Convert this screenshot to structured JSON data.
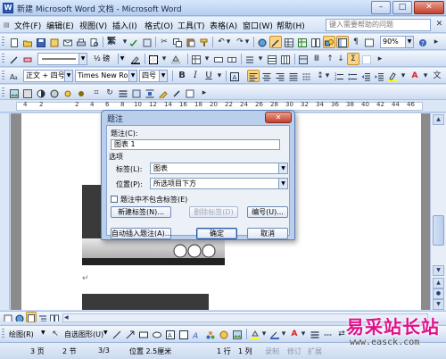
{
  "window": {
    "title": "新建 Microsoft Word 文档 - Microsoft Word"
  },
  "menu": {
    "items": [
      "文件(F)",
      "编辑(E)",
      "视图(V)",
      "插入(I)",
      "格式(O)",
      "工具(T)",
      "表格(A)",
      "窗口(W)",
      "帮助(H)"
    ],
    "help_placeholder": "键入需要帮助的问题"
  },
  "toolbar_standard": {
    "undo_dd": "▾",
    "zoom": "90%"
  },
  "toolbar_drawing_top": {
    "line_weight": "½ 磅"
  },
  "toolbar_formatting": {
    "style": "正文 + 四号",
    "font": "Times New Roman",
    "size": "四号",
    "bold": "B",
    "italic": "I",
    "underline": "U",
    "font_color_letter": "A"
  },
  "ruler": {
    "numbers": [
      "4",
      "2",
      "2",
      "4",
      "6",
      "8",
      "10",
      "12",
      "14",
      "16",
      "18",
      "20",
      "22",
      "24",
      "26",
      "28",
      "30",
      "32",
      "34",
      "36",
      "38",
      "40",
      "42",
      "44",
      "46"
    ]
  },
  "dialog": {
    "title": "题注",
    "close_glyph": "✕",
    "caption_label": "题注(C):",
    "caption_value": "图表 1",
    "options_label": "选项",
    "label_label": "标签(L):",
    "label_value": "图表",
    "position_label": "位置(P):",
    "position_value": "所选项目下方",
    "exclude_label": "题注中不包含标签(E)",
    "buttons": {
      "new_label": "新建标签(N)...",
      "delete_label": "删除标签(D)",
      "numbering": "编号(U)...",
      "autocaption": "自动插入题注(A)...",
      "ok": "确定",
      "cancel": "取消"
    }
  },
  "document": {
    "paragraph_mark": "↵"
  },
  "drawing_toolbar": {
    "draw": "绘图(R)",
    "autoshapes": "自选图形(U)"
  },
  "status_bar": {
    "page": "3 页",
    "section": "2 节",
    "page_of": "3/3",
    "position": "位置 2.5厘米",
    "line": "1 行",
    "column": "1 列",
    "rec": "录制",
    "trk": "修订",
    "ext": "扩展"
  },
  "watermark": {
    "logo": "易采站长站",
    "url": "www.easck.com"
  },
  "colors": {
    "accent_highlight": "#fbd485",
    "title_bar": "#b6cdee",
    "font_color": "#e02020",
    "watermark": "#e0108a"
  }
}
